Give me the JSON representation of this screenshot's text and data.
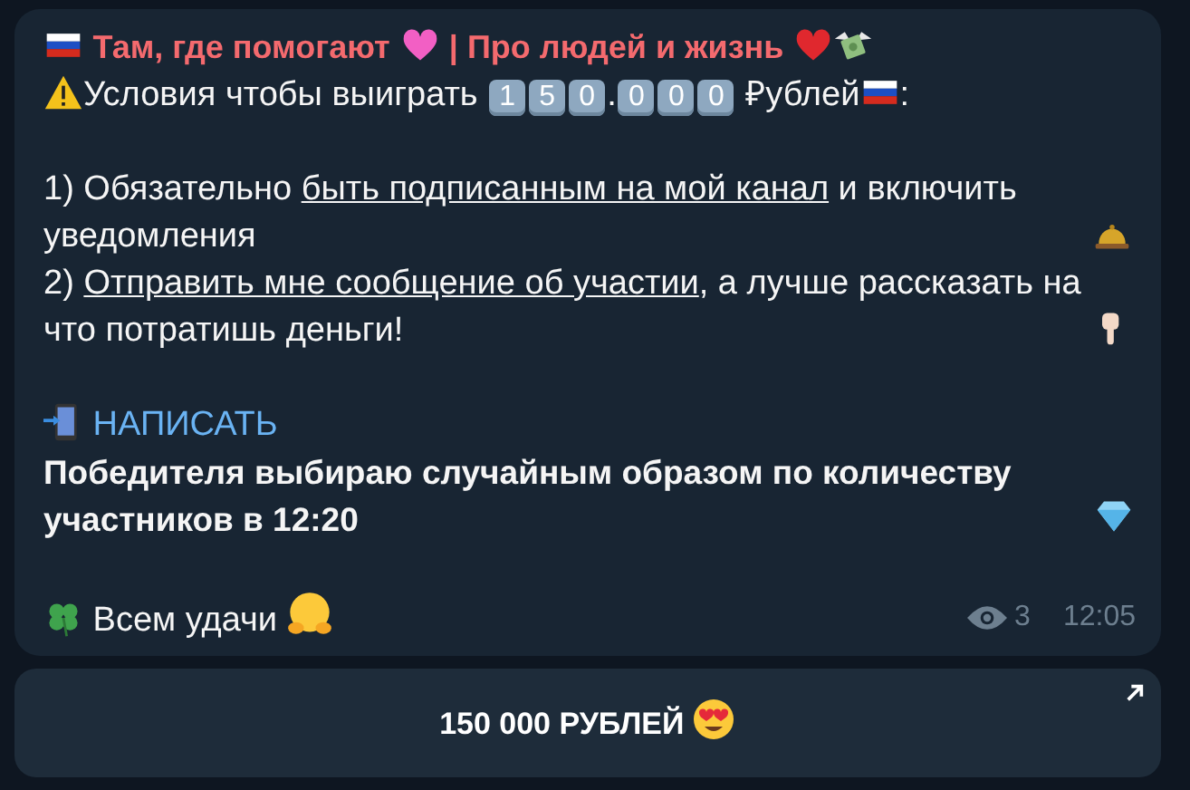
{
  "message": {
    "title_parts": [
      "Там, где помогают",
      "| Про людей и жизнь"
    ],
    "heading": {
      "before": "Условия чтобы выиграть",
      "keys": [
        {
          "kind": "key",
          "text": "1"
        },
        {
          "kind": "key",
          "text": "5"
        },
        {
          "kind": "key",
          "text": "0"
        },
        {
          "kind": "dot",
          "text": "."
        },
        {
          "kind": "key",
          "text": "0"
        },
        {
          "kind": "key",
          "text": "0"
        },
        {
          "kind": "key",
          "text": "0"
        }
      ],
      "after": "₽ублей",
      "end": ":"
    },
    "rules": [
      {
        "before": "1) Обязательно ",
        "link": "быть подписанным на мой канал",
        "after": " и включить уведомления"
      },
      {
        "before": "2) ",
        "link": "Отправить мне сообщение об участии",
        "after": ", а лучше рассказать на что потратишь деньги!"
      }
    ],
    "write_link": "НАПИСАТЬ",
    "winner_text": "Победителя выбираю случайным образом по количеству участников в 12:20",
    "wish": "Всем удачи",
    "views": "3",
    "time": "12:05"
  },
  "button": {
    "label": "150 000 РУБЛЕЙ"
  }
}
